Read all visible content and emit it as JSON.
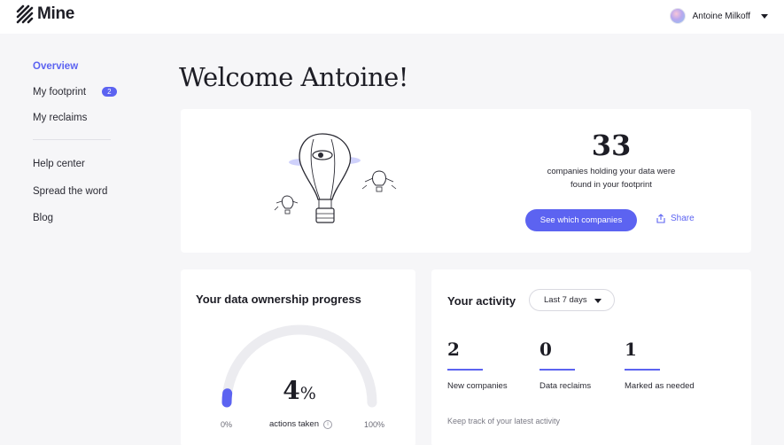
{
  "app": {
    "name": "Mine"
  },
  "user": {
    "name": "Antoine Milkoff"
  },
  "sidebar": {
    "items": [
      {
        "label": "Overview",
        "active": true
      },
      {
        "label": "My footprint",
        "badge": "2"
      },
      {
        "label": "My reclaims"
      },
      {
        "label": "Help center"
      },
      {
        "label": "Spread the word"
      },
      {
        "label": "Blog"
      }
    ]
  },
  "main": {
    "welcome": "Welcome Antoine!",
    "hero": {
      "count": "33",
      "text": "companies holding your data were found in your footprint",
      "cta_label": "See which companies",
      "share_label": "Share"
    },
    "progress": {
      "title": "Your data ownership progress",
      "percent": 4,
      "percent_sign": "%",
      "min_label": "0%",
      "max_label": "100%",
      "caption": "actions taken"
    },
    "activity": {
      "title": "Your activity",
      "period": "Last 7 days",
      "stats": [
        {
          "value": "2",
          "label": "New companies"
        },
        {
          "value": "0",
          "label": "Data reclaims"
        },
        {
          "value": "1",
          "label": "Marked as needed"
        }
      ],
      "note": "Keep track of your latest activity"
    }
  },
  "colors": {
    "accent": "#5c63f1",
    "text": "#1d1d25",
    "background": "#f6f6f8"
  },
  "icons": [
    "logo-icon",
    "avatar",
    "chevron-down-icon",
    "share-icon",
    "info-icon",
    "hot-air-balloon-illustration"
  ]
}
